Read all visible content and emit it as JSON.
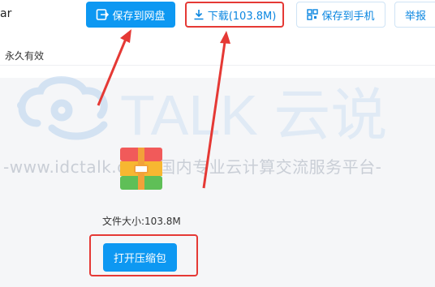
{
  "header": {
    "filename_tail": "ar",
    "validity": "永久有效"
  },
  "toolbar": {
    "save_netdisk_label": "保存到网盘",
    "download_label": "下载(103.8M)",
    "save_phone_label": "保存到手机",
    "report_label": "举报"
  },
  "watermark": {
    "brand": "TALK 云说",
    "slogan": "-www.idctalk.com-国内专业云计算交流服务平台-"
  },
  "file": {
    "size_label": "文件大小:103.8M",
    "open_label": "打开压缩包"
  },
  "colors": {
    "primary": "#0d98f2",
    "highlight": "#e53935",
    "watermark": "#c9ced6"
  }
}
